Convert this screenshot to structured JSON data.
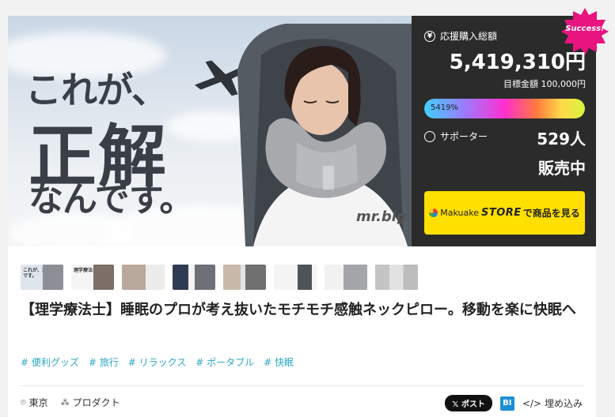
{
  "hero": {
    "headline_line1": "これが、",
    "headline_line2": "正解",
    "headline_line3": "なんです。",
    "brand": "mr.big"
  },
  "stats": {
    "badge": "Success!",
    "total_label": "応援購入総額",
    "total_icon": "¥",
    "total_amount": "5,419,310円",
    "goal": "目標金額 100,000円",
    "progress_percent_text": "5419%",
    "progress_fraction": 1.0,
    "supporters_label": "サポーター",
    "supporters_count": "529人",
    "status": "販売中",
    "store_button": {
      "brand": "Makuake",
      "store": "STORE",
      "action": "で商品を見る"
    }
  },
  "thumbnails": [
    {
      "caption": "これが、正解なんです。"
    },
    {
      "caption": "理学療法士"
    },
    {
      "caption": ""
    },
    {
      "caption": ""
    },
    {
      "caption": ""
    },
    {
      "caption": ""
    },
    {
      "caption": ""
    },
    {
      "caption": ""
    }
  ],
  "title": "【理学療法士】睡眠のプロが考え抜いたモチモチ感触ネックピロー。移動を楽に快眠へ",
  "tags": [
    "# 便利グッズ",
    "# 旅行",
    "# リラックス",
    "# ポータブル",
    "# 快眠"
  ],
  "meta": {
    "location": "東京",
    "category": "プロダクト"
  },
  "share": {
    "x_post": "𝕏 ポスト",
    "bi": "BI",
    "embed": "埋め込み"
  },
  "colors": {
    "panel_bg": "#2b2b2b",
    "badge": "#e8147f",
    "store_button": "#ffe000",
    "tag": "#2aa8c4"
  }
}
